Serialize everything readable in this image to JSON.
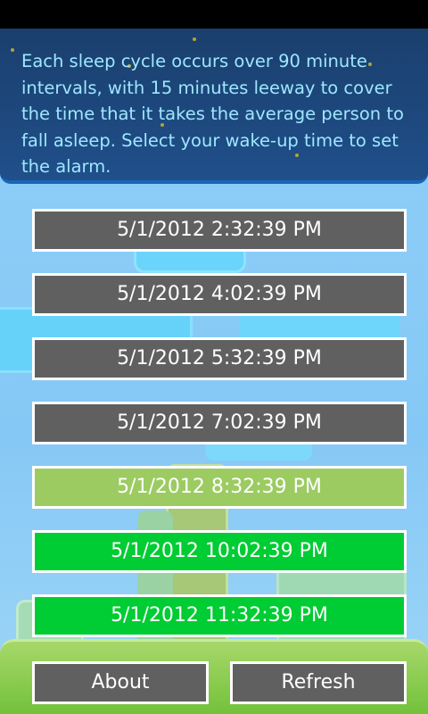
{
  "info": {
    "description": "Each sleep cycle occurs over 90 minute intervals, with 15 minutes leeway to cover the time that it takes the average person to fall asleep. Select your wake-up time to set the alarm."
  },
  "times": [
    {
      "label": "5/1/2012 2:32:39 PM",
      "color": "#606060"
    },
    {
      "label": "5/1/2012 4:02:39 PM",
      "color": "#606060"
    },
    {
      "label": "5/1/2012 5:32:39 PM",
      "color": "#606060"
    },
    {
      "label": "5/1/2012 7:02:39 PM",
      "color": "#606060"
    },
    {
      "label": "5/1/2012 8:32:39 PM",
      "color": "#9ccb62"
    },
    {
      "label": "5/1/2012 10:02:39 PM",
      "color": "#00cc33"
    },
    {
      "label": "5/1/2012 11:32:39 PM",
      "color": "#00cc33"
    }
  ],
  "footer": {
    "about_label": "About",
    "refresh_label": "Refresh"
  },
  "colors": {
    "header_bg": "#1e4d86",
    "info_text": "#9ee7ff",
    "button_gray": "#606060",
    "button_lightgreen": "#9ccb62",
    "button_green": "#00cc33",
    "footer_bg": "#8ccc50"
  }
}
